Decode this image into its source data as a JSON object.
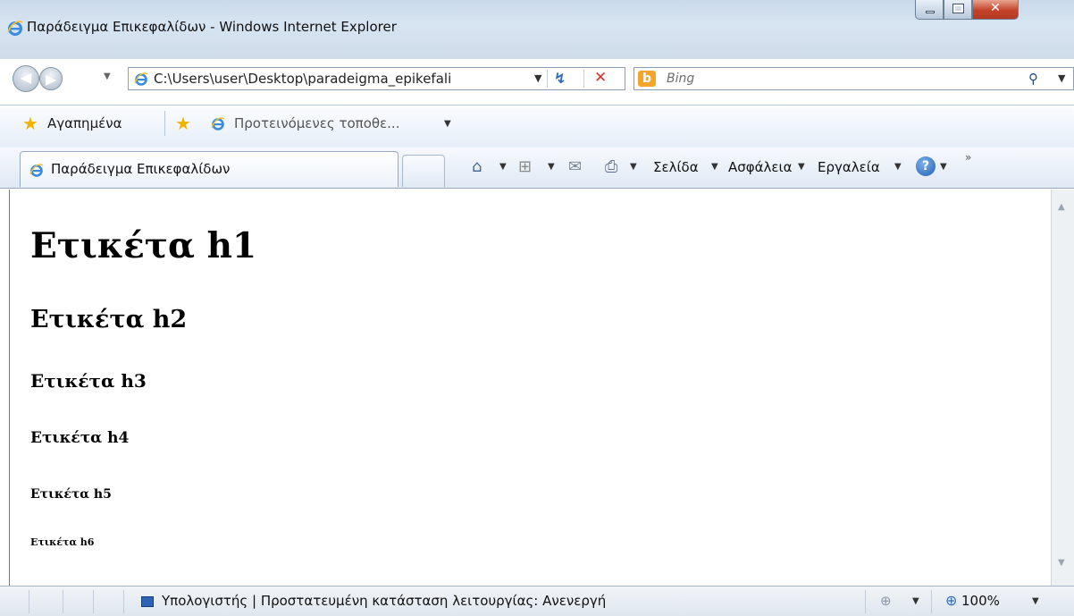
{
  "window": {
    "title": "Παράδειγμα Επικεφαλίδων - Windows Internet Explorer"
  },
  "address_bar": {
    "url": "C:\\Users\\user\\Desktop\\paradeigma_epikefali"
  },
  "search": {
    "placeholder": "Bing",
    "logo_text": "b"
  },
  "favorites_bar": {
    "favorites_label": "Αγαπημένα",
    "suggested_sites_label": "Προτεινόμενες τοποθε..."
  },
  "tab": {
    "label": "Παράδειγμα Επικεφαλίδων"
  },
  "command_bar": {
    "page_label": "Σελίδα",
    "safety_label": "Ασφάλεια",
    "tools_label": "Εργαλεία",
    "help_glyph": "?"
  },
  "content": {
    "h1": "Ετικέτα h1",
    "h2": "Ετικέτα h2",
    "h3": "Ετικέτα h3",
    "h4": "Ετικέτα h4",
    "h5": "Ετικέτα h5",
    "h6": "Ετικέτα h6"
  },
  "status_bar": {
    "zone_text": "Υπολογιστής | Προστατευμένη κατάσταση λειτουργίας: Ανενεργή",
    "zoom": "100%"
  },
  "colors": {
    "title_bar": "#c9d9ea",
    "close_button": "#c4432a",
    "link_blue": "#2d6ac0",
    "bing_orange": "#f3a52b"
  }
}
